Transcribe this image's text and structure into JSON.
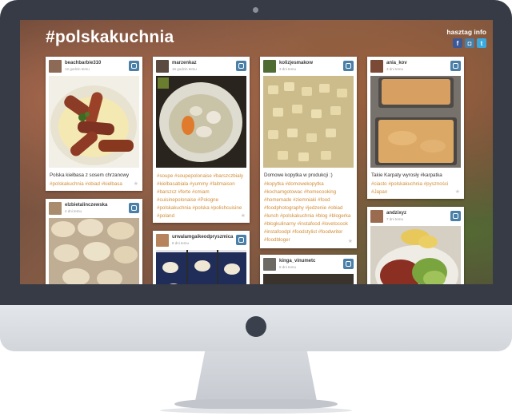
{
  "header": {
    "hashtag": "#polskakuchnia",
    "info_label": "hasztag info"
  },
  "social": [
    {
      "icon": "facebook-icon",
      "glyph": "f",
      "color": "#3b5998"
    },
    {
      "icon": "instagram-icon",
      "glyph": "◘",
      "color": "#4a7fa8"
    },
    {
      "icon": "twitter-icon",
      "glyph": "t",
      "color": "#39a9e0"
    }
  ],
  "posts": [
    {
      "user": "beachbarbie310",
      "time": "12 godzin temu",
      "caption": "Polska kiełbasa z sosem chrzanowy",
      "tags": "#polskakuchnia #obiad #kielbasa"
    },
    {
      "user": "elzbietalinczewska",
      "time": "4 dni temu",
      "caption": "",
      "tags": ""
    },
    {
      "user": "marzenkaz",
      "time": "16 godzin temu",
      "caption": "",
      "tags": "#soupe #soupepolonaise #barszczbialy #kielbasabiala #yummy #faitmaison #barszcz #ferte #cmiam #cuisinepolonaise #Pologne #polskakuchnia #polska #polishcuisine #poland"
    },
    {
      "user": "urwalamgaikeodpryszmica",
      "time": "8 dni temu",
      "caption": "",
      "tags": ""
    },
    {
      "user": "kolizjesmakow",
      "time": "3 dni temu",
      "caption": "Domowe kopytka w produkcji :)",
      "tags": "#kopytka #domowekopytka #kochamgotowac #homecooking #homemade #ziemniaki #food #foodphotography #jedzenie #obiad #lunch #polskakuchnia #blog #blogerka #blogkulinarny #instafood #lovetocook #instafoodpl #foodstylist #foodwriter #foodbloger"
    },
    {
      "user": "kinga_vinumetc",
      "time": "8 dni temu",
      "caption": "",
      "tags": ""
    },
    {
      "user": "ania_kov",
      "time": "3 dni temu",
      "caption": "Takie Karpaty wyrosły #karpatka",
      "tags": "#ciasto #polskakuchnia #pyszności #Japan"
    },
    {
      "user": "andzixyz",
      "time": "7 dni temu",
      "caption": "",
      "tags": ""
    }
  ]
}
